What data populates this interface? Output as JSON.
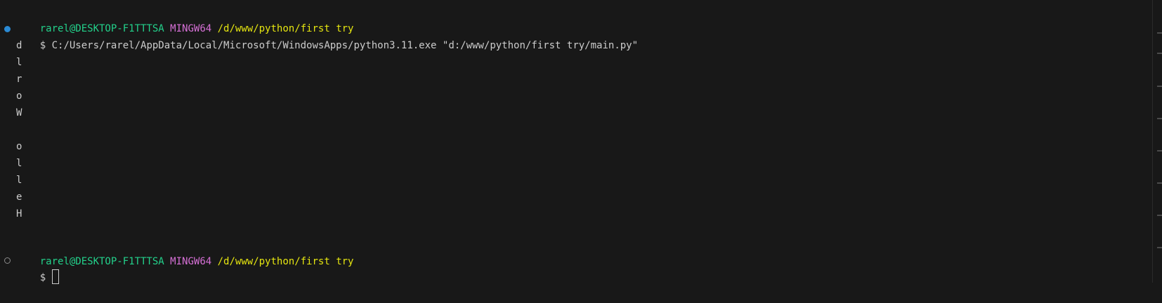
{
  "prompt1": {
    "user": "rarel@DESKTOP-F1TTTSA",
    "system": "MINGW64",
    "path": "/d/www/python/first try"
  },
  "command_line": {
    "symbol": "$",
    "command": "C:/Users/rarel/AppData/Local/Microsoft/WindowsApps/python3.11.exe \"d:/www/python/first try/main.py\""
  },
  "output": [
    "d",
    "l",
    "r",
    "o",
    "W",
    "",
    "o",
    "l",
    "l",
    "e",
    "H"
  ],
  "prompt2": {
    "user": "rarel@DESKTOP-F1TTTSA",
    "system": "MINGW64",
    "path": "/d/www/python/first try"
  },
  "input_line": {
    "symbol": "$",
    "value": ""
  },
  "colors": {
    "background": "#181818",
    "user": "#23d18b",
    "system": "#d670d6",
    "path": "#e5e510",
    "text": "#cccccc",
    "success_decoration": "#2a8ad4"
  }
}
